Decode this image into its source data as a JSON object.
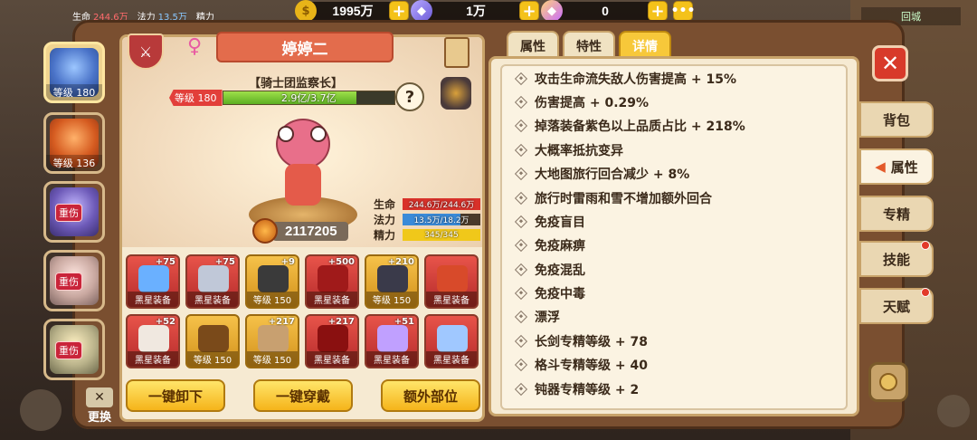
{
  "resources": {
    "gold": "1995万",
    "diamond": "1万",
    "gem": "0"
  },
  "mini_info": {
    "hp_label": "生命",
    "hp_value": "244.6万",
    "mp_label": "法力",
    "mp_value": "13.5万",
    "sp_label": "精力"
  },
  "top_right_label": "回城",
  "portraits": [
    {
      "level": "等级 180",
      "badge": ""
    },
    {
      "level": "等级 136",
      "badge": ""
    },
    {
      "level": "",
      "badge": "重伤"
    },
    {
      "level": "",
      "badge": "重伤"
    },
    {
      "level": "",
      "badge": "重伤"
    }
  ],
  "character": {
    "name": "婷婷二",
    "title": "【骑士团监察长】",
    "level_tag": "等级 180",
    "hp_text": "2.9亿/3.7亿",
    "hp_fraction": 0.78,
    "power": "2117205",
    "help": "?"
  },
  "stats": [
    {
      "label": "生命",
      "value": "244.6万/244.6万",
      "color": "#d8312a",
      "fraction": 1.0
    },
    {
      "label": "法力",
      "value": "13.5万/18.2万",
      "color": "#3a8ad8",
      "fraction": 0.74
    },
    {
      "label": "精力",
      "value": "345/345",
      "color": "#f0c81a",
      "fraction": 1.0
    }
  ],
  "equipment": [
    {
      "caption": "黑星装备",
      "plus": "+75",
      "style": "red",
      "item_color": "#6ab0ff"
    },
    {
      "caption": "黑星装备",
      "plus": "+75",
      "style": "red",
      "item_color": "#c0c8d8"
    },
    {
      "caption": "等级 150",
      "plus": "+9",
      "style": "gold",
      "item_color": "#3a3a3a"
    },
    {
      "caption": "黑星装备",
      "plus": "+500",
      "style": "red",
      "item_color": "#a01a1a"
    },
    {
      "caption": "等级 150",
      "plus": "+210",
      "style": "gold",
      "item_color": "#3a3a4a"
    },
    {
      "caption": "黑星装备",
      "plus": "",
      "style": "red",
      "item_color": "#d84a2a"
    },
    {
      "caption": "黑星装备",
      "plus": "+52",
      "style": "red",
      "item_color": "#f0e8e0"
    },
    {
      "caption": "等级 150",
      "plus": "",
      "style": "gold",
      "item_color": "#7a4a1a"
    },
    {
      "caption": "等级 150",
      "plus": "+217",
      "style": "gold",
      "item_color": "#c8a070"
    },
    {
      "caption": "黑星装备",
      "plus": "+217",
      "style": "red",
      "item_color": "#8a1010"
    },
    {
      "caption": "黑星装备",
      "plus": "+51",
      "style": "red",
      "item_color": "#c0a0ff"
    },
    {
      "caption": "黑星装备",
      "plus": "",
      "style": "red",
      "item_color": "#a0c8ff"
    }
  ],
  "actions": {
    "unequip_all": "一键卸下",
    "equip_all": "一键穿戴",
    "extra_slots": "额外部位"
  },
  "swap_label": "更换",
  "tabs": [
    "属性",
    "特性",
    "详情"
  ],
  "active_tab": "详情",
  "details": [
    "攻击生命流失敌人伤害提高 + 15%",
    "伤害提高 + 0.29%",
    "掉落装备紫色以上品质占比 + 218%",
    "大概率抵抗变异",
    "大地图旅行回合减少 + 8%",
    "旅行时雷雨和雪不增加额外回合",
    "免疫盲目",
    "免疫麻痹",
    "免疫混乱",
    "免疫中毒",
    "漂浮",
    "长剑专精等级 + 78",
    "格斗专精等级 + 40",
    "钝器专精等级 + 2"
  ],
  "side_tabs": [
    {
      "label": "背包",
      "dot": false
    },
    {
      "label": "属性",
      "dot": false
    },
    {
      "label": "专精",
      "dot": false
    },
    {
      "label": "技能",
      "dot": true
    },
    {
      "label": "天赋",
      "dot": true
    }
  ],
  "close": "✕"
}
